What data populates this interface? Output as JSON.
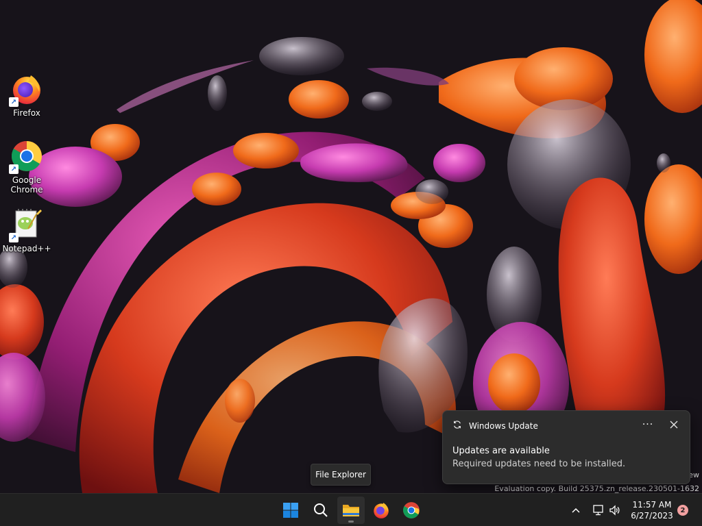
{
  "desktop": {
    "icons": [
      {
        "label": "Firefox",
        "icon": "firefox-icon"
      },
      {
        "label": "Google Chrome",
        "icon": "chrome-icon"
      },
      {
        "label": "Notepad++",
        "icon": "notepad-plus-plus-icon"
      }
    ],
    "watermark_line1": "ew",
    "watermark_line2": "Evaluation copy. Build 25375.zn_release.230501-1632"
  },
  "tooltip": {
    "text": "File Explorer"
  },
  "notification": {
    "app": "Windows Update",
    "app_icon": "sync-icon",
    "more_label": "···",
    "title": "Updates are available",
    "body": "Required updates need to be installed."
  },
  "taskbar": {
    "buttons": [
      {
        "name": "start",
        "icon": "windows-logo-icon"
      },
      {
        "name": "search",
        "icon": "search-icon"
      },
      {
        "name": "file-explorer",
        "icon": "folder-icon",
        "active": true
      },
      {
        "name": "firefox",
        "icon": "firefox-icon"
      },
      {
        "name": "chrome",
        "icon": "chrome-icon"
      }
    ],
    "tray": {
      "chevron": "chevron-up-icon",
      "network": "network-icon",
      "volume": "speaker-icon"
    },
    "clock": {
      "time": "11:57 AM",
      "date": "6/27/2023"
    },
    "notification_count": "2"
  },
  "colors": {
    "accent_blue": "#0078d4",
    "folder_yellow": "#f8c63b",
    "taskbar_bg": "#202020",
    "toast_bg": "#2c2c2c",
    "badge": "#f2a0a0"
  }
}
